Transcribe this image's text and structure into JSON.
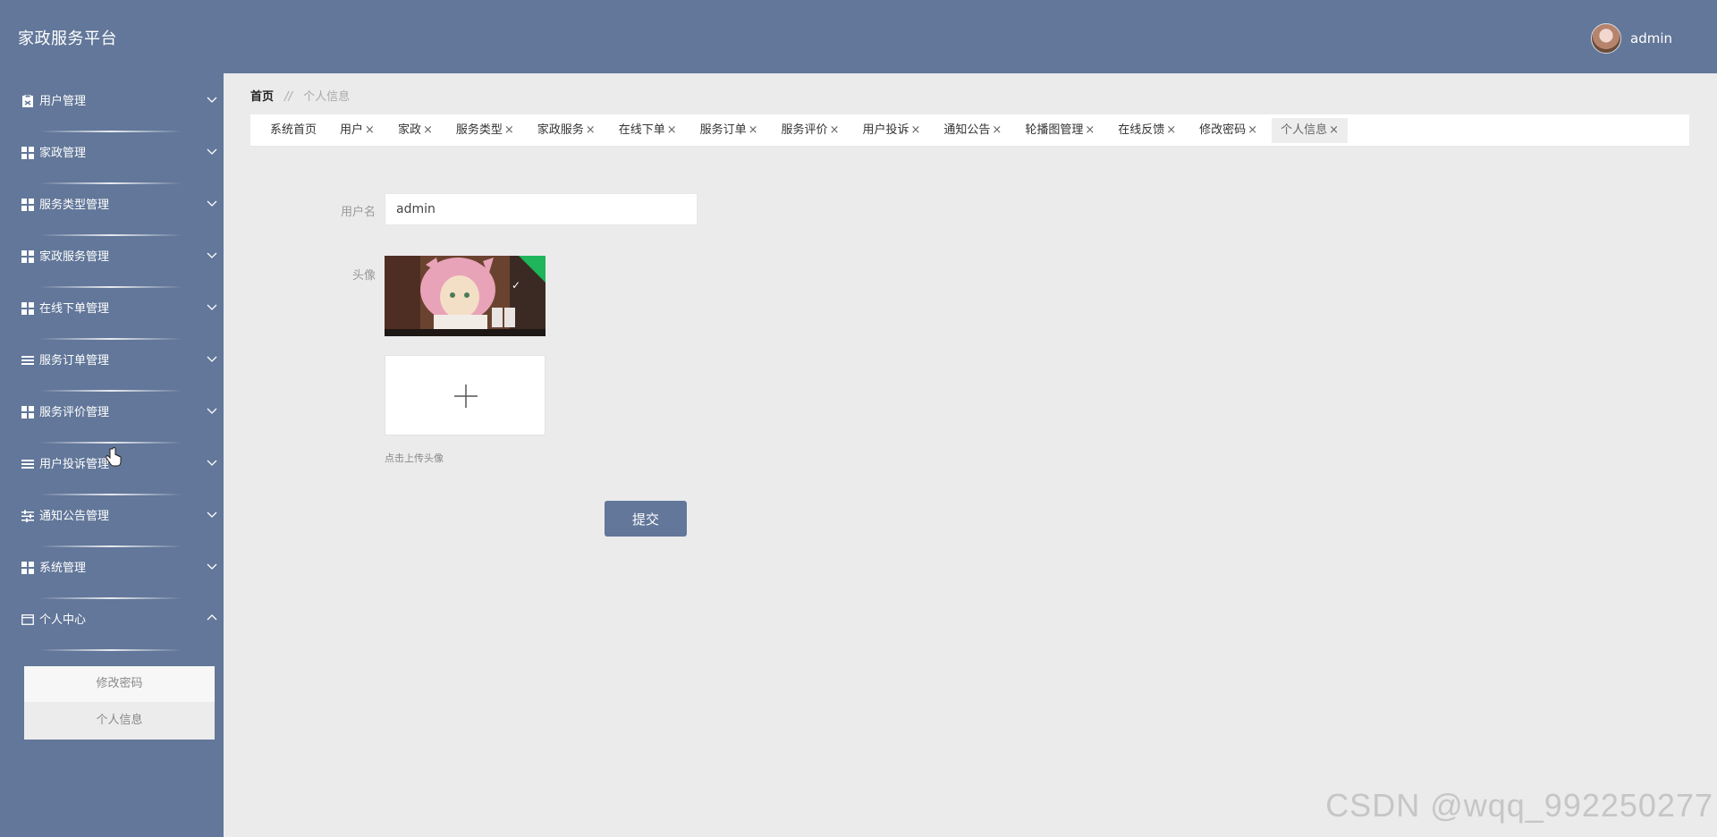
{
  "header": {
    "app_title": "家政服务平台",
    "username": "admin"
  },
  "sidebar": {
    "items": [
      {
        "label": "用户管理",
        "icon": "clipboard-user-icon",
        "expanded": false
      },
      {
        "label": "家政管理",
        "icon": "grid-icon",
        "expanded": false
      },
      {
        "label": "服务类型管理",
        "icon": "grid-icon",
        "expanded": false
      },
      {
        "label": "家政服务管理",
        "icon": "grid-icon",
        "expanded": false
      },
      {
        "label": "在线下单管理",
        "icon": "grid-icon",
        "expanded": false
      },
      {
        "label": "服务订单管理",
        "icon": "list-icon",
        "expanded": false
      },
      {
        "label": "服务评价管理",
        "icon": "grid-icon",
        "expanded": false
      },
      {
        "label": "用户投诉管理",
        "icon": "list-icon",
        "expanded": false
      },
      {
        "label": "通知公告管理",
        "icon": "sliders-icon",
        "expanded": false
      },
      {
        "label": "系统管理",
        "icon": "grid-icon",
        "expanded": false
      },
      {
        "label": "个人中心",
        "icon": "card-icon",
        "expanded": true
      }
    ],
    "submenu": [
      {
        "label": "修改密码",
        "active": false
      },
      {
        "label": "个人信息",
        "active": true
      }
    ]
  },
  "breadcrumb": {
    "home": "首页",
    "separator": "//",
    "current": "个人信息"
  },
  "tabs": [
    {
      "label": "系统首页",
      "closable": false,
      "active": false
    },
    {
      "label": "用户",
      "closable": true,
      "active": false
    },
    {
      "label": "家政",
      "closable": true,
      "active": false
    },
    {
      "label": "服务类型",
      "closable": true,
      "active": false
    },
    {
      "label": "家政服务",
      "closable": true,
      "active": false
    },
    {
      "label": "在线下单",
      "closable": true,
      "active": false
    },
    {
      "label": "服务订单",
      "closable": true,
      "active": false
    },
    {
      "label": "服务评价",
      "closable": true,
      "active": false
    },
    {
      "label": "用户投诉",
      "closable": true,
      "active": false
    },
    {
      "label": "通知公告",
      "closable": true,
      "active": false
    },
    {
      "label": "轮播图管理",
      "closable": true,
      "active": false
    },
    {
      "label": "在线反馈",
      "closable": true,
      "active": false
    },
    {
      "label": "修改密码",
      "closable": true,
      "active": false
    },
    {
      "label": "个人信息",
      "closable": true,
      "active": true
    }
  ],
  "tab_close_glyph": "×",
  "form": {
    "username_label": "用户名",
    "username_value": "admin",
    "avatar_label": "头像",
    "upload_tip": "点击上传头像",
    "submit_label": "提交"
  },
  "watermark": "CSDN @wqq_992250277",
  "colors": {
    "primary": "#627799",
    "background": "#ebebec",
    "success": "#1fb55a"
  }
}
